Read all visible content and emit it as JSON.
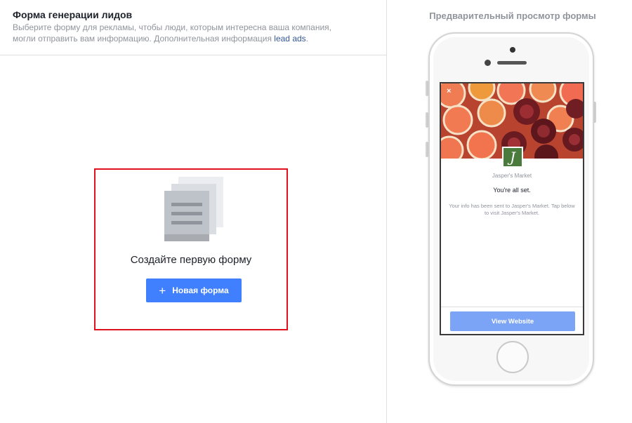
{
  "left_panel": {
    "title": "Форма генерации лидов",
    "description": "Выберите форму для рекламы, чтобы люди, которым интересна ваша компания, могли отправить вам информацию. Дополнительная информация",
    "link_text": "lead ads",
    "link_suffix": ".",
    "empty_state_title": "Создайте первую форму",
    "new_form_button": "Новая форма",
    "new_form_icon": "plus-icon",
    "highlight_color": "#e0111f",
    "accent_color": "#4080ff"
  },
  "preview": {
    "title": "Предварительный просмотр формы",
    "close_glyph": "×",
    "logo_letter": "J",
    "company_name": "Jasper's Market",
    "done_title": "You're all set.",
    "done_message": "Your info has been sent to Jasper's Market. Tap below to visit Jasper's Market.",
    "view_button": "View Website",
    "button_color": "#7ba4f6",
    "logo_color": "#4a7a3c"
  }
}
